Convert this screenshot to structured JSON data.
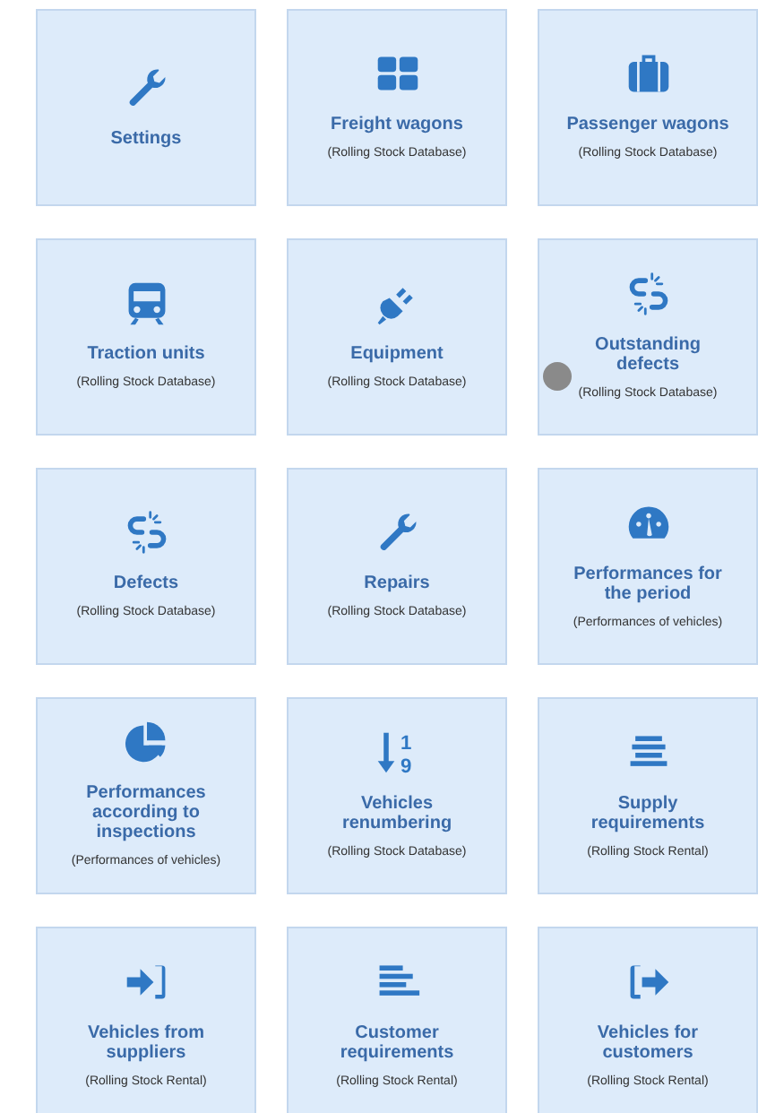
{
  "tiles": [
    {
      "kind": "wrench",
      "title": "Settings"
    },
    {
      "kind": "grid",
      "title": "Freight wagons",
      "subtitle": "(Rolling Stock Database)"
    },
    {
      "kind": "briefcase",
      "title": "Passenger wagons",
      "subtitle": "(Rolling Stock Database)"
    },
    {
      "kind": "train",
      "title": "Traction units",
      "subtitle": "(Rolling Stock Database)"
    },
    {
      "kind": "plug",
      "title": "Equipment",
      "subtitle": "(Rolling Stock Database)"
    },
    {
      "kind": "broken-link",
      "title": "Outstanding defects",
      "subtitle": "(Rolling Stock Database)"
    },
    {
      "kind": "broken-link",
      "title": "Defects",
      "subtitle": "(Rolling Stock Database)"
    },
    {
      "kind": "wrench",
      "title": "Repairs",
      "subtitle": "(Rolling Stock Database)"
    },
    {
      "kind": "gauge",
      "title": "Performances for the period",
      "subtitle": "(Performances of vehicles)"
    },
    {
      "kind": "pie",
      "title": "Performances according to inspections",
      "subtitle": "(Performances of vehicles)"
    },
    {
      "title": "Vehicles renumbering",
      "subtitle": "(Rolling Stock Database)",
      "kind": "sort",
      "icon_glyphs": [
        "1",
        "9"
      ]
    },
    {
      "kind": "lines-center",
      "title": "Supply requirements",
      "subtitle": "(Rolling Stock Rental)"
    },
    {
      "kind": "sign-in",
      "title": "Vehicles from suppliers",
      "subtitle": "(Rolling Stock Rental)"
    },
    {
      "kind": "lines-left",
      "title": "Customer requirements",
      "subtitle": "(Rolling Stock Rental)"
    },
    {
      "kind": "sign-out",
      "title": "Vehicles for customers",
      "subtitle": "(Rolling Stock Rental)"
    }
  ]
}
